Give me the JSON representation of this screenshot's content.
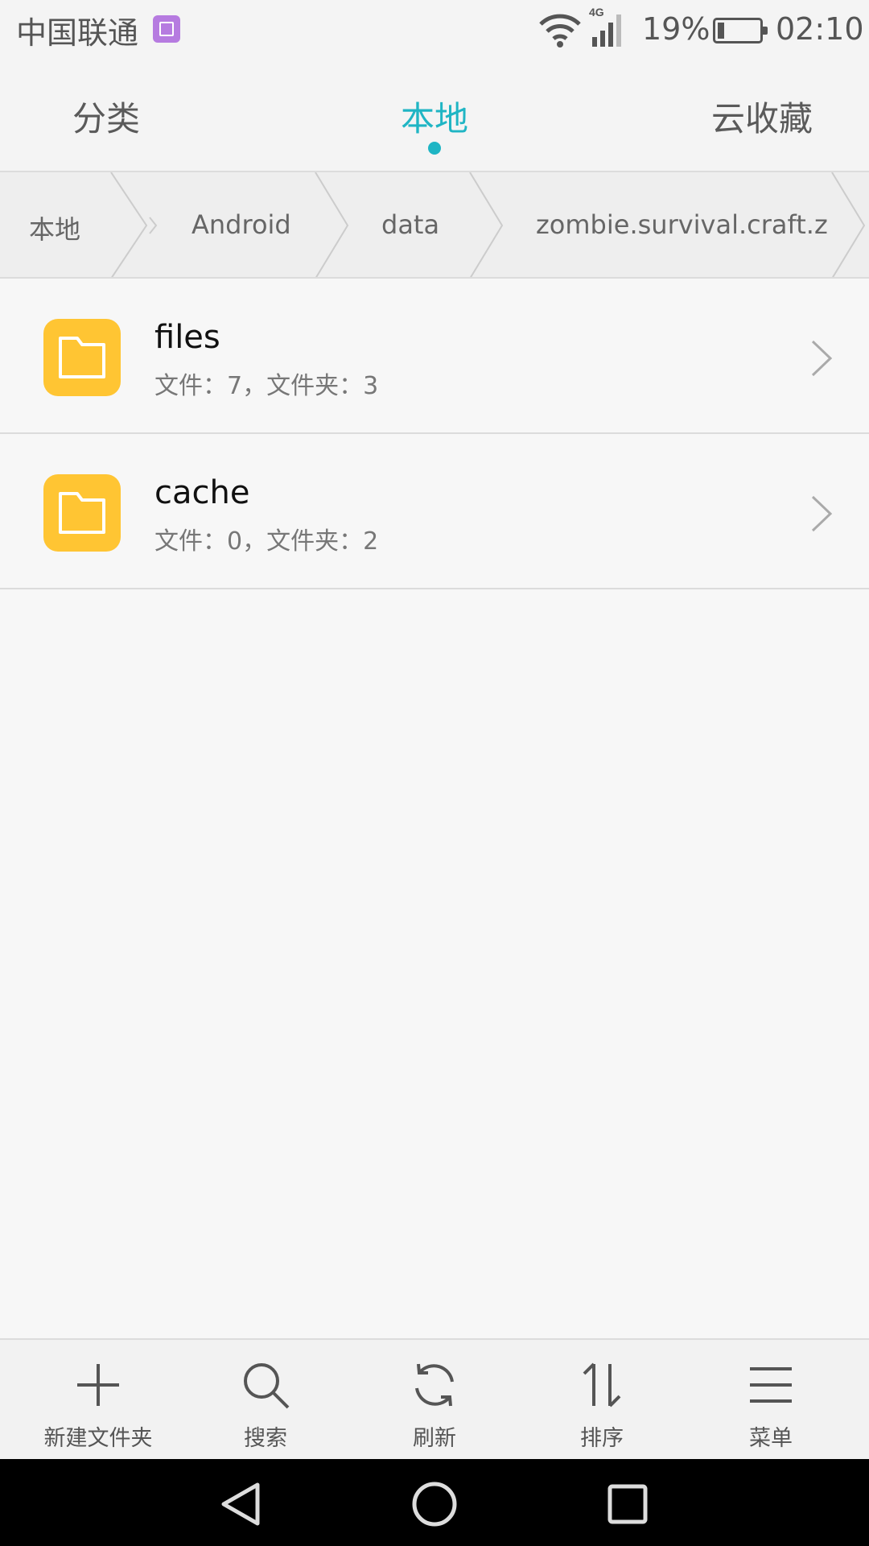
{
  "status_bar": {
    "carrier": "中国联通",
    "network": "4G",
    "battery": "19%",
    "time": "02:10"
  },
  "tabs": [
    {
      "label": "分类",
      "active": false
    },
    {
      "label": "本地",
      "active": true
    },
    {
      "label": "云收藏",
      "active": false
    }
  ],
  "breadcrumb": [
    "本地",
    "Android",
    "data",
    "zombie.survival.craft.z"
  ],
  "items": [
    {
      "name": "files",
      "meta": "文件：7，文件夹：3"
    },
    {
      "name": "cache",
      "meta": "文件：0，文件夹：2"
    }
  ],
  "toolbar": [
    {
      "label": "新建文件夹",
      "icon": "plus-icon"
    },
    {
      "label": "搜索",
      "icon": "search-icon"
    },
    {
      "label": "刷新",
      "icon": "refresh-icon"
    },
    {
      "label": "排序",
      "icon": "sort-icon"
    },
    {
      "label": "菜单",
      "icon": "menu-icon"
    }
  ],
  "colors": {
    "accent": "#1fb5c4",
    "folder": "#ffc533",
    "album_icon": "#b67be0"
  }
}
